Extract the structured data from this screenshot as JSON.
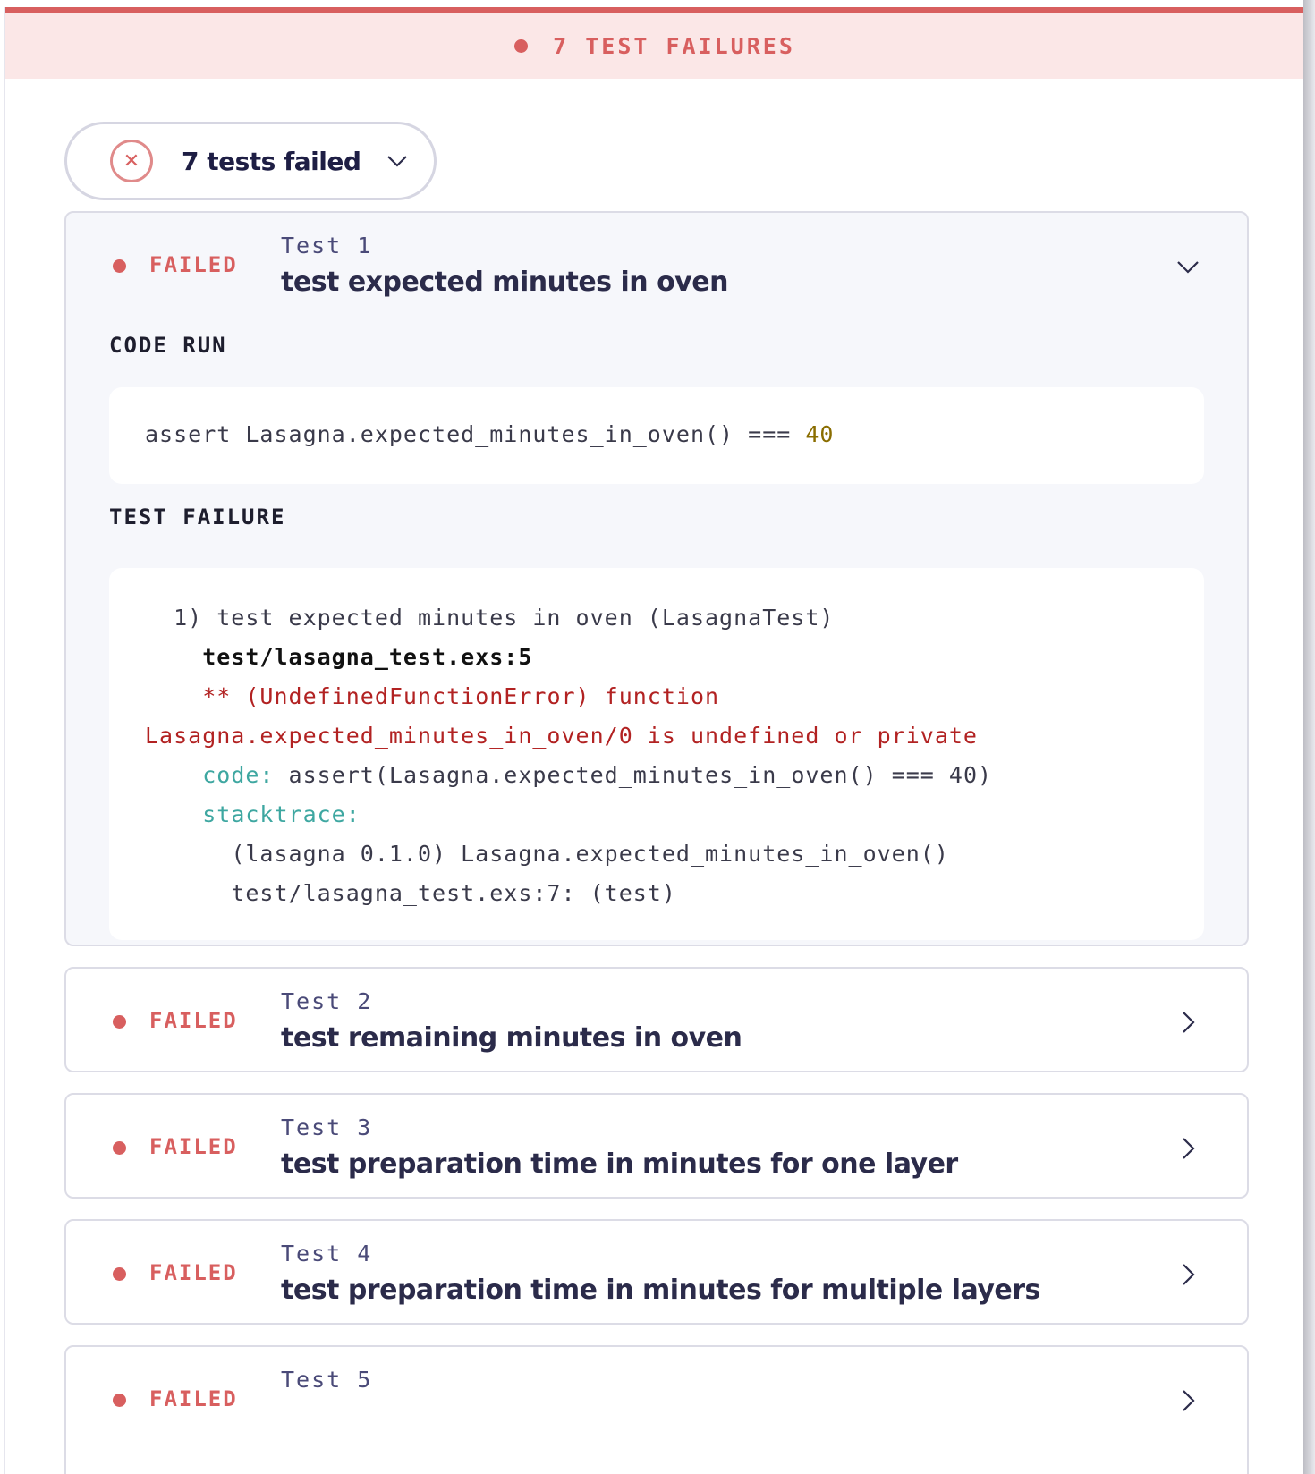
{
  "banner": {
    "text": "7 TEST FAILURES",
    "color": "#d85f5f"
  },
  "summary": {
    "label": "7 tests failed",
    "icon": "close-icon"
  },
  "tests": [
    {
      "status": "FAILED",
      "number": "Test 1",
      "name": "test expected minutes in oven",
      "expanded": true,
      "code_run_title": "CODE RUN",
      "code_run": {
        "prefix": "assert Lasagna.expected_minutes_in_oven() === ",
        "value": "40"
      },
      "failure_title": "TEST FAILURE",
      "failure": {
        "line1": "  1) test expected minutes in oven (LasagnaTest)",
        "line2": "test/lasagna_test.exs:5",
        "line3": "** (UndefinedFunctionError) function",
        "line4": "Lasagna.expected_minutes_in_oven/0 is undefined or private",
        "line5_key": "code:",
        "line5_val": " assert(Lasagna.expected_minutes_in_oven() === 40)",
        "line6_key": "stacktrace:",
        "line7": "(lasagna 0.1.0) Lasagna.expected_minutes_in_oven()",
        "line8": "test/lasagna_test.exs:7: (test)"
      }
    },
    {
      "status": "FAILED",
      "number": "Test 2",
      "name": "test remaining minutes in oven",
      "expanded": false
    },
    {
      "status": "FAILED",
      "number": "Test 3",
      "name": "test preparation time in minutes for one layer",
      "expanded": false
    },
    {
      "status": "FAILED",
      "number": "Test 4",
      "name": "test preparation time in minutes for multiple layers",
      "expanded": false
    },
    {
      "status": "FAILED",
      "number": "Test 5",
      "name": "",
      "expanded": false
    }
  ]
}
